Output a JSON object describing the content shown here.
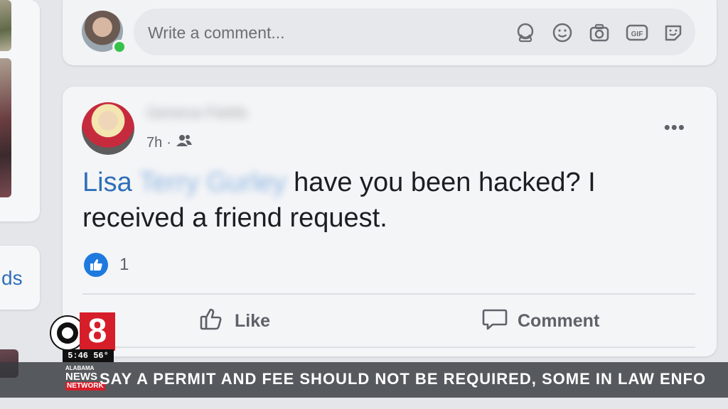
{
  "comment_box": {
    "placeholder": "Write a comment...",
    "icons": [
      "avatar-sticker-icon",
      "emoji-icon",
      "camera-icon",
      "gif-icon",
      "sticker-icon"
    ],
    "icon_gif_label": "GIF"
  },
  "sidebar": {
    "partial_text": "ds"
  },
  "post": {
    "author": "Geneva Fields",
    "time": "7h",
    "separator": "·",
    "audience": "friends-icon",
    "more": "•••",
    "mention_first": "Lisa",
    "mention_last": "Terry Gurley",
    "text_line_1": " have you been hacked? I",
    "text_line_2": "received a friend request.",
    "reaction_count": "1",
    "like_label": "Like",
    "comment_label": "Comment"
  },
  "overlay": {
    "channel_number": "8",
    "clock": "5:46 56°",
    "brand_line1": "ALABAMA",
    "brand_line2": "NEWS",
    "brand_line3": "NETWORK",
    "ticker": "SAY A PERMIT AND FEE SHOULD NOT BE REQUIRED, SOME IN LAW ENFO"
  },
  "colors": {
    "link": "#2f6fb8",
    "like_blue": "#1f7ae0",
    "cbs_red": "#d61e2a"
  }
}
